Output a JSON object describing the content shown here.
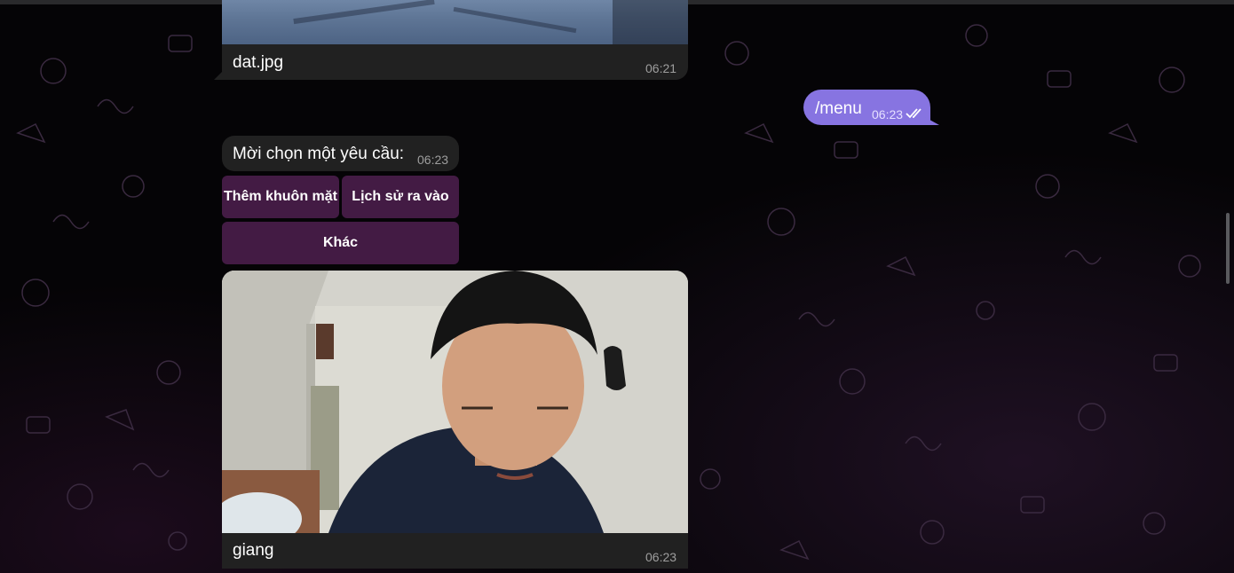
{
  "messages": [
    {
      "id": "photo-dat",
      "caption": "dat.jpg",
      "time": "06:21"
    },
    {
      "id": "menu-cmd",
      "text": "/menu",
      "time": "06:23",
      "status_icon": "double-check-icon"
    },
    {
      "id": "bot-prompt",
      "text": "Mời chọn một yêu cầu:",
      "time": "06:23"
    },
    {
      "id": "photo-giang",
      "caption": "giang",
      "time": "06:23"
    }
  ],
  "keyboard": {
    "row1": [
      "Thêm khuôn mặt",
      "Lịch sử ra vào"
    ],
    "row2": [
      "Khác"
    ]
  },
  "colors": {
    "outgoing_bubble": "#8774e1",
    "incoming_bubble": "#212121",
    "inline_button": "#431b44"
  }
}
